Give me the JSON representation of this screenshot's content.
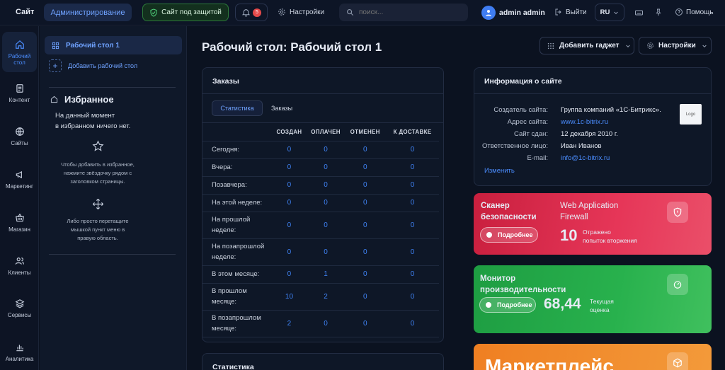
{
  "topbar": {
    "site": "Сайт",
    "admin": "Администрирование",
    "secure": "Сайт под защитой",
    "notif_count": "5",
    "settings": "Настройки",
    "search_placeholder": "поиск...",
    "user": "admin admin",
    "logout": "Выйти",
    "lang": "RU",
    "help": "Помощь"
  },
  "sidebar": {
    "items": [
      {
        "label1": "Рабочий",
        "label2": "стол",
        "icon": "home-icon"
      },
      {
        "label1": "Контент",
        "label2": "",
        "icon": "document-icon"
      },
      {
        "label1": "Сайты",
        "label2": "",
        "icon": "globe-icon"
      },
      {
        "label1": "Маркетинг",
        "label2": "",
        "icon": "megaphone-icon"
      },
      {
        "label1": "Магазин",
        "label2": "",
        "icon": "basket-icon"
      },
      {
        "label1": "Клиенты",
        "label2": "",
        "icon": "users-icon"
      },
      {
        "label1": "Сервисы",
        "label2": "",
        "icon": "layers-icon"
      },
      {
        "label1": "Аналитика",
        "label2": "",
        "icon": "chart-icon"
      }
    ]
  },
  "panel": {
    "desktop": "Рабочий стол 1",
    "add_desktop": "Добавить рабочий стол",
    "favorites_title": "Избранное",
    "empty_line1": "На данный момент",
    "empty_line2": "в избранном ничего нет.",
    "hint1_l1": "Чтобы добавить в избранное,",
    "hint1_l2": "нажмите звёздочку рядом с",
    "hint1_l3": "заголовком страницы.",
    "hint2_l1": "Либо просто перетащите",
    "hint2_l2": "мышкой пункт меню в",
    "hint2_l3": "правую область."
  },
  "main": {
    "title": "Рабочий стол: Рабочий стол 1",
    "add_gadget": "Добавить гаджет",
    "settings": "Настройки"
  },
  "orders": {
    "title": "Заказы",
    "tabs": [
      "Статистика",
      "Заказы"
    ],
    "columns": [
      "СОЗДАН",
      "ОПЛАЧЕН",
      "ОТМЕНЕН",
      "К ДОСТАВКЕ"
    ],
    "rows": [
      {
        "l1": "Сегодня:",
        "l2": "",
        "v": [
          "0",
          "0",
          "0",
          "0"
        ]
      },
      {
        "l1": "Вчера:",
        "l2": "",
        "v": [
          "0",
          "0",
          "0",
          "0"
        ]
      },
      {
        "l1": "Позавчера:",
        "l2": "",
        "v": [
          "0",
          "0",
          "0",
          "0"
        ]
      },
      {
        "l1": "На этой неделе:",
        "l2": "",
        "v": [
          "0",
          "0",
          "0",
          "0"
        ]
      },
      {
        "l1": "На прошлой",
        "l2": "неделе:",
        "v": [
          "0",
          "0",
          "0",
          "0"
        ]
      },
      {
        "l1": "На позапрошлой",
        "l2": "неделе:",
        "v": [
          "0",
          "0",
          "0",
          "0"
        ]
      },
      {
        "l1": "В этом месяце:",
        "l2": "",
        "v": [
          "0",
          "1",
          "0",
          "0"
        ]
      },
      {
        "l1": "В прошлом",
        "l2": "месяце:",
        "v": [
          "10",
          "2",
          "0",
          "0"
        ]
      },
      {
        "l1": "В позапрошлом",
        "l2": "месяце:",
        "v": [
          "2",
          "0",
          "0",
          "0"
        ]
      }
    ]
  },
  "stats": {
    "title": "Статистика"
  },
  "info": {
    "title": "Информация о сайте",
    "rows": [
      {
        "k": "Создатель сайта:",
        "v": "Группа компаний «1С-Битрикс»."
      },
      {
        "k": "Адрес сайта:",
        "v": "www.1c-bitrix.ru"
      },
      {
        "k": "Сайт сдан:",
        "v": "12 декабря 2010 г."
      },
      {
        "k": "Ответственное лицо:",
        "v": "Иван Иванов"
      },
      {
        "k": "E-mail:",
        "v": "info@1c-bitrix.ru"
      }
    ],
    "logo": "Logo",
    "edit": "Изменить"
  },
  "scanner": {
    "title1": "Сканер",
    "title2": "безопасности",
    "waf1": "Web Application",
    "waf2": "Firewall",
    "more": "Подробнее",
    "count": "10",
    "desc1": "Отражено",
    "desc2": "попыток вторжения"
  },
  "monitor": {
    "title1": "Монитор",
    "title2": "производительности",
    "more": "Подробнее",
    "score": "68,44",
    "desc1": "Текущая",
    "desc2": "оценка"
  },
  "market": {
    "title": "Маркетплейс"
  },
  "colors": {
    "accent": "#3b82f6",
    "scanner_bg": "#d8284a",
    "monitor_bg": "#22a84a",
    "market_bg": "#f08a2a"
  }
}
